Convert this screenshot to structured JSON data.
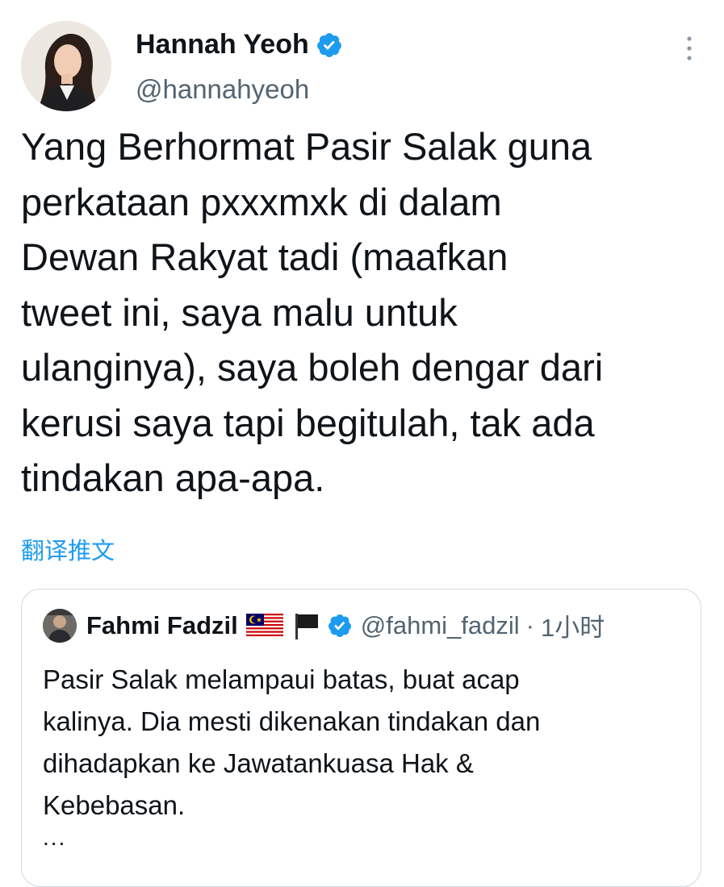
{
  "author": {
    "display_name": "Hannah Yeoh",
    "handle": "@hannahyeoh"
  },
  "tweet": {
    "lines": [
      "Yang Berhormat Pasir Salak guna",
      "perkataan pxxxmxk di dalam",
      "Dewan Rakyat tadi (maafkan",
      "tweet ini, saya malu untuk",
      "ulanginya), saya boleh dengar dari",
      "kerusi saya tapi begitulah, tak ada",
      "tindakan apa-apa."
    ],
    "translate_label": "翻译推文"
  },
  "quote": {
    "display_name": "Fahmi Fadzil",
    "handle": "@fahmi_fadzil",
    "separator": "·",
    "time": "1小时",
    "lines": [
      "Pasir Salak melampaui batas, buat acap",
      "kalinya. Dia mesti dikenakan tindakan dan",
      "dihadapkan ke Jawatankuasa Hak &",
      "Kebebasan."
    ],
    "ellipsis": "..."
  },
  "icons": {
    "verified": "verified-badge-icon",
    "more": "more-vertical-icon",
    "flag_malaysia": "malaysia-flag-icon",
    "flag_black": "black-flag-icon"
  },
  "colors": {
    "link_blue": "#1d9bf0",
    "secondary_text": "#536471",
    "border": "#cfd9de"
  }
}
